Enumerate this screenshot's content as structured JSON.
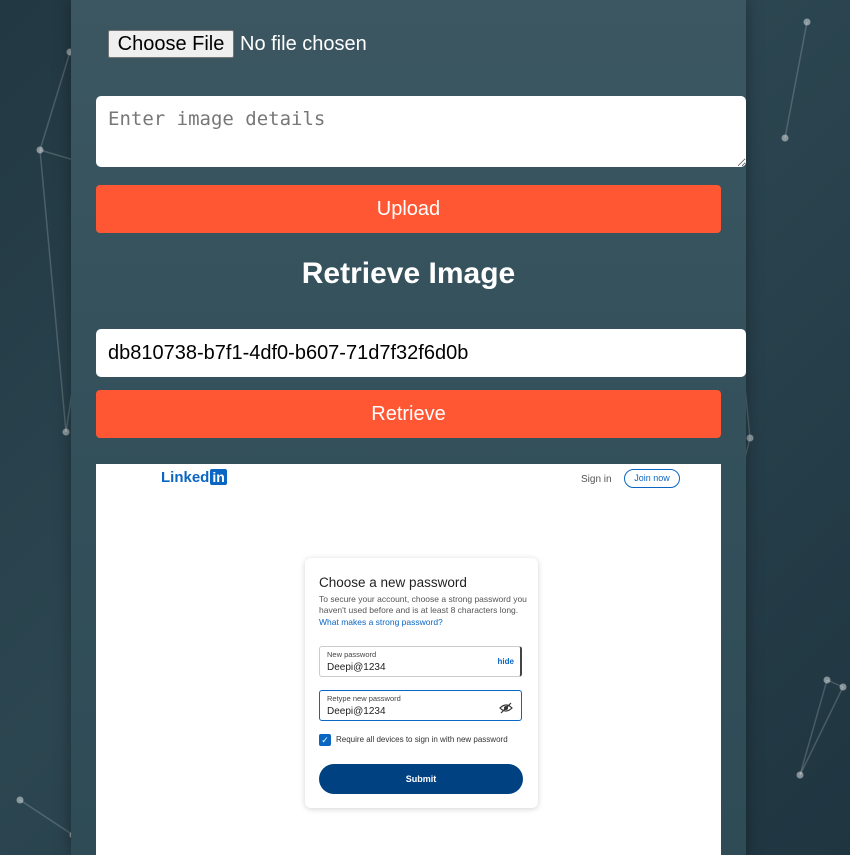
{
  "uploader": {
    "choose_file_label": "Choose File",
    "file_status": "No file chosen",
    "details_placeholder": "Enter image details",
    "upload_label": "Upload"
  },
  "retrieve": {
    "heading": "Retrieve Image",
    "id_value": "db810738-b7f1-4df0-b607-71d7f32f6d0b",
    "retrieve_label": "Retrieve"
  },
  "retrieved_image": {
    "logo_text": "Linked",
    "logo_box": "in",
    "sign_in": "Sign in",
    "join_now": "Join now",
    "card": {
      "title": "Choose a new password",
      "description": "To secure your account, choose a strong password you haven't used before and is at least 8 characters long.",
      "link": "What makes a strong password?",
      "new_password_label": "New password",
      "new_password_value": "Deepi@1234",
      "hide_label": "hide",
      "retype_label": "Retype new password",
      "retype_value": "Deepi@1234",
      "checkbox_label": "Require all devices to sign in with new password",
      "submit_label": "Submit"
    }
  },
  "colors": {
    "button": "#ff5733",
    "linkedin_blue": "#0a66c2",
    "submit": "#004182"
  }
}
